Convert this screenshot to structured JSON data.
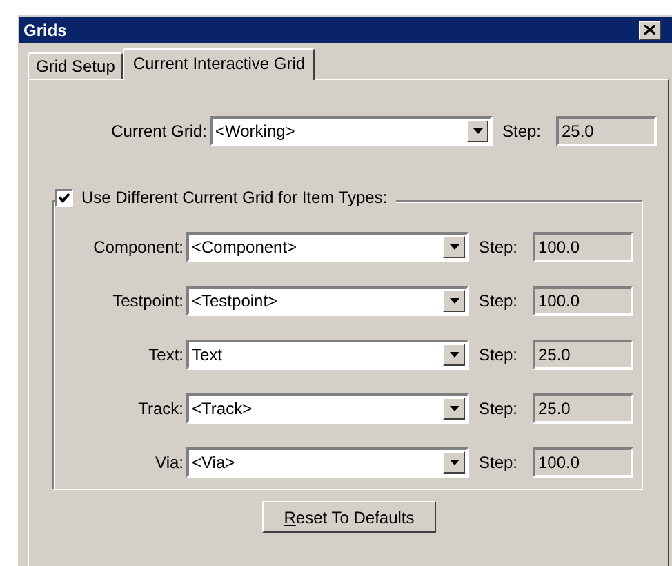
{
  "window": {
    "title": "Grids"
  },
  "tabs": [
    {
      "label": "Grid Setup",
      "selected": false
    },
    {
      "label": "Current Interactive Grid",
      "selected": true
    }
  ],
  "current_grid": {
    "label": "Current Grid:",
    "value": "<Working>",
    "step_label": "Step:",
    "step": "25.0"
  },
  "item_types": {
    "label": "Use Different Current Grid for Item Types:",
    "checked": true,
    "rows": [
      {
        "label": "Component:",
        "value": "<Component>",
        "step_label": "Step:",
        "step": "100.0"
      },
      {
        "label": "Testpoint:",
        "value": "<Testpoint>",
        "step_label": "Step:",
        "step": "100.0"
      },
      {
        "label": "Text:",
        "value": "Text",
        "step_label": "Step:",
        "step": "25.0"
      },
      {
        "label": "Track:",
        "value": "<Track>",
        "step_label": "Step:",
        "step": "25.0"
      },
      {
        "label": "Via:",
        "value": "<Via>",
        "step_label": "Step:",
        "step": "100.0"
      }
    ]
  },
  "buttons": [
    {
      "label": "Reset To Defaults"
    }
  ]
}
